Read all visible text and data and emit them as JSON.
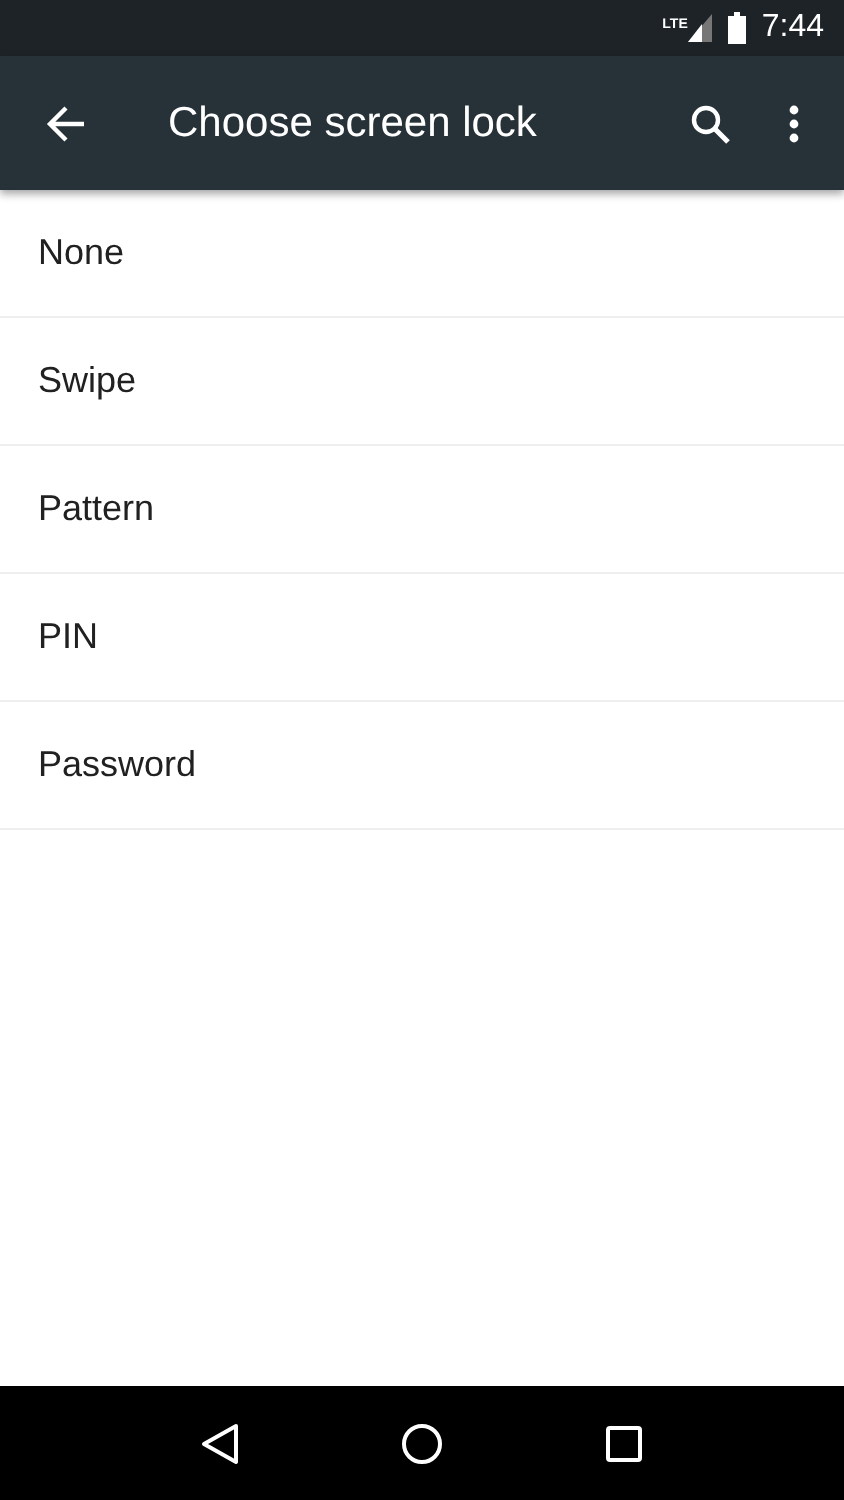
{
  "status_bar": {
    "network": "LTE",
    "time": "7:44"
  },
  "app_bar": {
    "title": "Choose screen lock"
  },
  "options": [
    {
      "label": "None"
    },
    {
      "label": "Swipe"
    },
    {
      "label": "Pattern"
    },
    {
      "label": "PIN"
    },
    {
      "label": "Password"
    }
  ]
}
